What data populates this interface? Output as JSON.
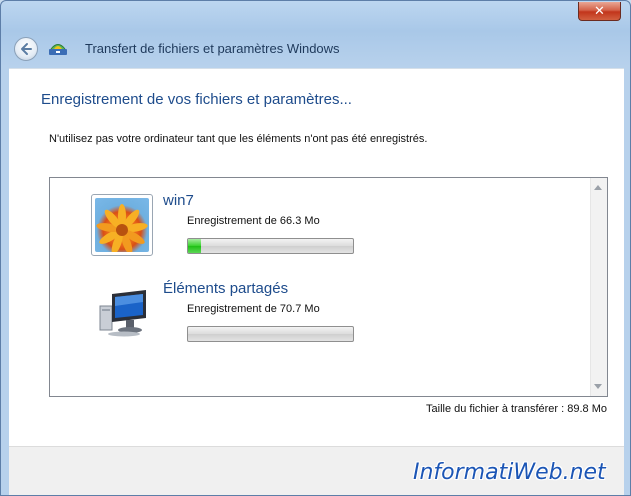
{
  "window": {
    "title": "Transfert de fichiers et paramètres Windows",
    "close_label": "✕"
  },
  "icons": {
    "back": "back-arrow-icon",
    "app": "windows-easy-transfer-icon",
    "user": "user-account-picture-icon",
    "shared": "computer-icon"
  },
  "main": {
    "heading": "Enregistrement de vos fichiers et paramètres...",
    "instruction": "N'utilisez pas votre ordinateur tant que les éléments n'ont pas été enregistrés."
  },
  "items": [
    {
      "name": "win7",
      "status": "Enregistrement de 66.3 Mo",
      "progress_percent": 8
    },
    {
      "name": "Éléments partagés",
      "status": "Enregistrement de 70.7 Mo",
      "progress_percent": 0
    }
  ],
  "total_label": "Taille du fichier à transférer : 89.8 Mo",
  "watermark": "InformatiWeb.net",
  "colors": {
    "heading": "#1e4c8c",
    "progress_fill": "#37d12b"
  }
}
